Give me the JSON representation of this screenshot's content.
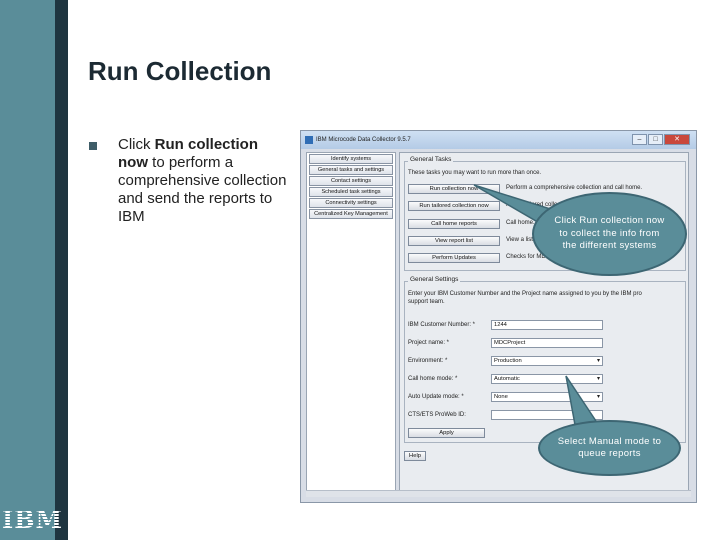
{
  "slide": {
    "title": "Run Collection",
    "bullet_prefix": "Click ",
    "bullet_bold": "Run collection now",
    "bullet_suffix": " to perform a comprehensive collection and send the reports to IBM",
    "logo_text": "IBM"
  },
  "window": {
    "title": "IBM Microcode Data Collector 9.5.7",
    "controls": [
      "–",
      "□",
      "✕"
    ],
    "nav_items": [
      "Identify systems",
      "General tasks and settings",
      "Contact settings",
      "Scheduled task settings",
      "Connectivity settings",
      "Centralized Key Management"
    ],
    "general_tasks": {
      "title": "General Tasks",
      "intro": "These tasks you may want to run more than once.",
      "buttons": [
        {
          "label": "Run collection now",
          "desc": "Perform a comprehensive collection and call home."
        },
        {
          "label": "Run tailored collection now",
          "desc": "Run a tailored collection for specific systems..."
        },
        {
          "label": "Call home reports",
          "desc": "Call home..."
        },
        {
          "label": "View report list",
          "desc": "View a list..."
        },
        {
          "label": "Perform Updates",
          "desc": "Checks for MDC..."
        }
      ]
    },
    "general_settings": {
      "title": "General Settings",
      "intro_line1": "Enter your IBM Customer Number and the Project name assigned to you by the IBM pro",
      "intro_line2": "support team.",
      "fields": [
        {
          "label": "IBM Customer Number: *",
          "value": "1244",
          "type": "text"
        },
        {
          "label": "Project name: *",
          "value": "MDCProject",
          "type": "text"
        },
        {
          "label": "Environment: *",
          "value": "Production",
          "type": "combo"
        },
        {
          "label": "Call home mode: *",
          "value": "Automatic",
          "type": "combo"
        },
        {
          "label": "Auto Update mode: *",
          "value": "None",
          "type": "combo"
        },
        {
          "label": "CTS/ETS ProWeb ID:",
          "value": "",
          "type": "text"
        }
      ],
      "apply_label": "Apply"
    },
    "help_label": "Help"
  },
  "callouts": {
    "run_collection": "Click Run collection now to collect the info from the different systems",
    "manual_mode": "Select Manual mode to queue reports"
  },
  "colors": {
    "accent": "#5a8d99",
    "dark_strip": "#1f3540"
  }
}
